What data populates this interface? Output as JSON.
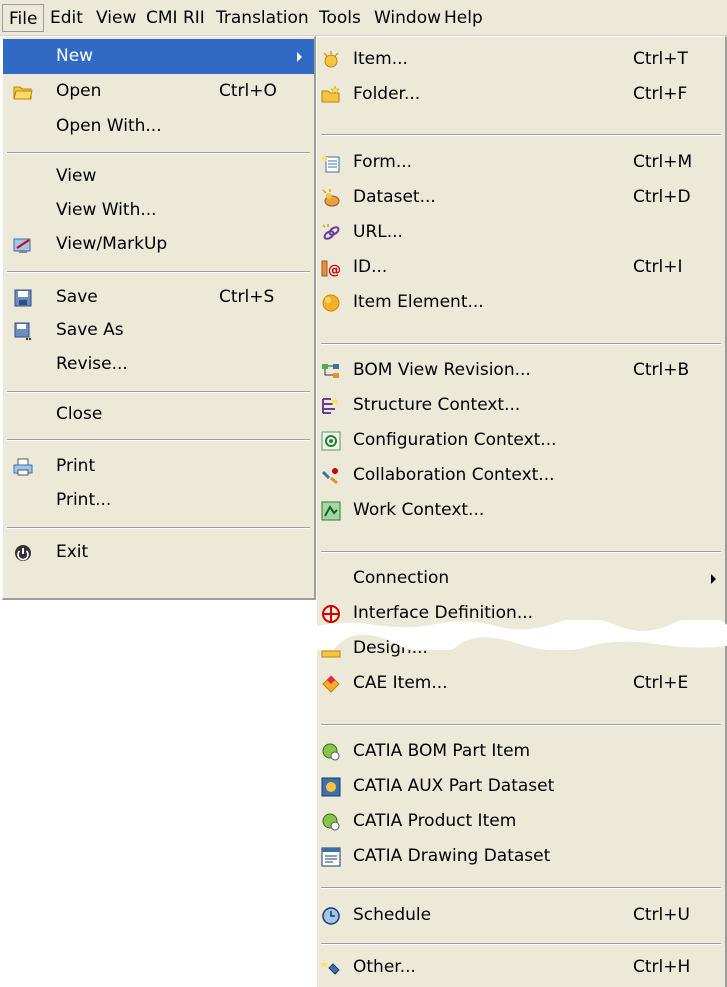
{
  "menubar": {
    "items": [
      "File",
      "Edit",
      "View",
      "CMI RII",
      "Translation",
      "Tools",
      "Window",
      "Help"
    ]
  },
  "file_menu": {
    "new": "New",
    "open": "Open",
    "open_acc": "Ctrl+O",
    "open_with": "Open With...",
    "view": "View",
    "view_with": "View With...",
    "view_markup": "View/MarkUp",
    "save": "Save",
    "save_acc": "Ctrl+S",
    "save_as": "Save As",
    "revise": "Revise...",
    "close": "Close",
    "print_icon_item": "Print",
    "print_dialog": "Print...",
    "exit": "Exit"
  },
  "new_menu": {
    "item": "Item...",
    "item_acc": "Ctrl+T",
    "folder": "Folder...",
    "folder_acc": "Ctrl+F",
    "form": "Form...",
    "form_acc": "Ctrl+M",
    "dataset": "Dataset...",
    "dataset_acc": "Ctrl+D",
    "url": "URL...",
    "id": "ID...",
    "id_acc": "Ctrl+I",
    "item_element": "Item Element...",
    "bom_view_revision": "BOM View Revision...",
    "bom_acc": "Ctrl+B",
    "structure_context": "Structure Context...",
    "configuration_context": "Configuration Context...",
    "collaboration_context": "Collaboration Context...",
    "work_context": "Work Context...",
    "connection": "Connection",
    "interface_definition": "Interface Definition...",
    "design": "Design...",
    "cae_item": "CAE Item...",
    "cae_acc": "Ctrl+E",
    "catia_bom_part_item": "CATIA BOM Part Item",
    "catia_aux_part_dataset": "CATIA AUX Part Dataset",
    "catia_product_item": "CATIA Product Item",
    "catia_drawing_dataset": "CATIA Drawing Dataset",
    "schedule": "Schedule",
    "schedule_acc": "Ctrl+U",
    "other": "Other...",
    "other_acc": "Ctrl+H"
  },
  "colors": {
    "menu_bg": "#ece9d8",
    "highlight": "#316ac5"
  }
}
